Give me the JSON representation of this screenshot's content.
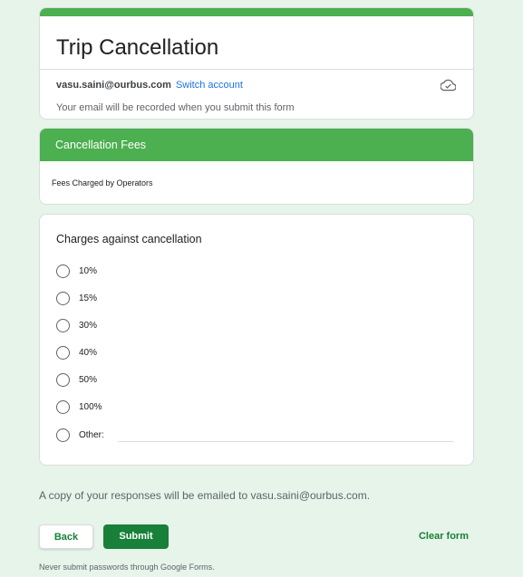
{
  "form": {
    "title": "Trip Cancellation",
    "account_email": "vasu.saini@ourbus.com",
    "switch_account_label": "Switch account",
    "email_notice": "Your email will be recorded when you submit this form"
  },
  "section": {
    "title": "Cancellation Fees",
    "description": "Fees Charged by Operators"
  },
  "question": {
    "title": "Charges against cancellation",
    "options": [
      "10%",
      "15%",
      "30%",
      "40%",
      "50%",
      "100%",
      "Other:"
    ]
  },
  "copy_note": "A copy of your responses will be emailed to vasu.saini@ourbus.com.",
  "buttons": {
    "back": "Back",
    "submit": "Submit",
    "clear": "Clear form"
  },
  "footer_note": "Never submit passwords through Google Forms.",
  "colors": {
    "accent": "#4caf50",
    "primary_button": "#188038",
    "link": "#1a73e8",
    "background": "#e6f4ea"
  },
  "icons": {
    "cloud": "cloud-check-icon",
    "radio": "radio-unchecked-icon"
  }
}
